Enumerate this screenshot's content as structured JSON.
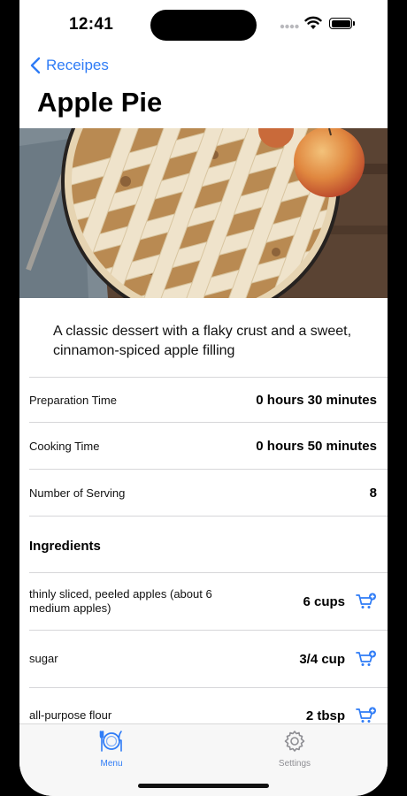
{
  "status": {
    "time": "12:41"
  },
  "nav": {
    "back_label": "Receipes",
    "title": "Apple Pie"
  },
  "recipe": {
    "description": "A classic dessert with a flaky crust and a sweet, cinnamon-spiced apple filling",
    "details": [
      {
        "label": "Preparation Time",
        "value": "0 hours 30 minutes"
      },
      {
        "label": "Cooking Time",
        "value": "0 hours 50 minutes"
      },
      {
        "label": "Number of Serving",
        "value": "8"
      }
    ],
    "ingredients_heading": "Ingredients",
    "ingredients": [
      {
        "name": "thinly sliced, peeled apples (about 6 medium apples)",
        "amount": "6 cups"
      },
      {
        "name": "sugar",
        "amount": "3/4 cup"
      },
      {
        "name": "all-purpose flour",
        "amount": "2 tbsp"
      }
    ]
  },
  "tabs": [
    {
      "label": "Menu",
      "icon": "fork-knife-plate-icon",
      "selected": true
    },
    {
      "label": "Settings",
      "icon": "gear-icon",
      "selected": false
    }
  ],
  "colors": {
    "accent": "#2f7cf6",
    "inactive": "#8e8e93",
    "separator": "#d6d6d9"
  }
}
